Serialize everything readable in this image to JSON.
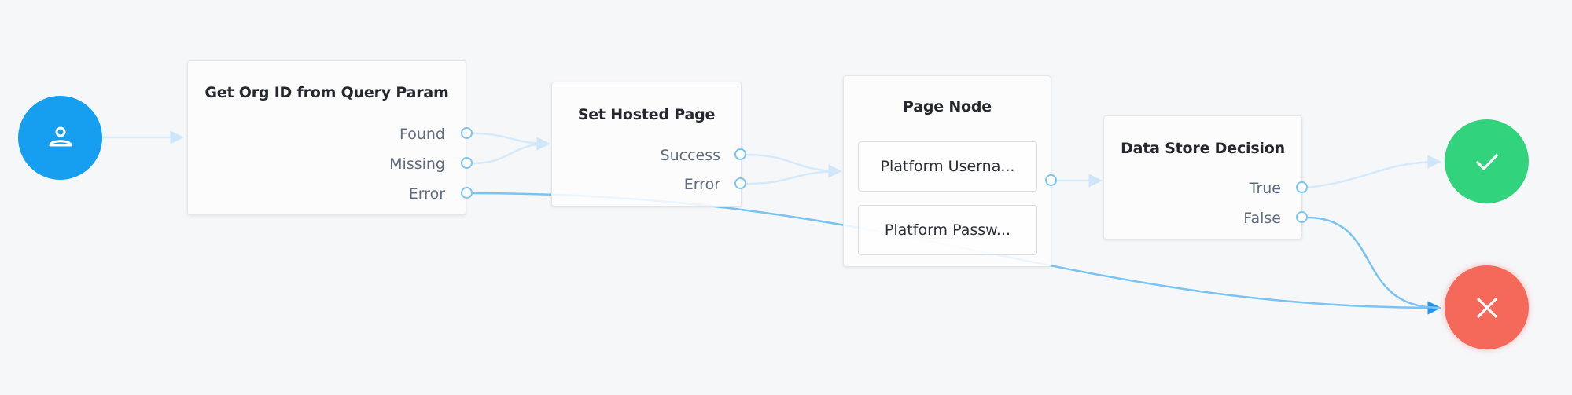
{
  "colors": {
    "background": "#f6f7f9",
    "start": "#169ff0",
    "success": "#31d47d",
    "failure": "#f5695b",
    "edge_inactive": "#d4e9fa",
    "edge_active": "#79c3f3",
    "port": "#7cc4f4",
    "outcome_text": "#5f6b80",
    "title_text": "#24272d"
  },
  "start_node": {
    "icon": "user-icon"
  },
  "nodes": [
    {
      "id": "get-org-id",
      "title": "Get Org ID from Query Param",
      "outcomes": [
        "Found",
        "Missing",
        "Error"
      ]
    },
    {
      "id": "set-hosted-page",
      "title": "Set Hosted Page",
      "outcomes": [
        "Success",
        "Error"
      ]
    },
    {
      "id": "page-node",
      "title": "Page Node",
      "children": [
        "Platform Userna...",
        "Platform Passw..."
      ]
    },
    {
      "id": "data-store-decision",
      "title": "Data Store Decision",
      "outcomes": [
        "True",
        "False"
      ]
    }
  ],
  "success_node": {
    "icon": "check-icon"
  },
  "failure_node": {
    "icon": "x-icon"
  },
  "edges": [
    {
      "from": "start",
      "to": "Get Org ID from Query Param",
      "active": false
    },
    {
      "from": "Get Org ID from Query Param:Found",
      "to": "Set Hosted Page",
      "active": false
    },
    {
      "from": "Get Org ID from Query Param:Missing",
      "to": "Set Hosted Page",
      "active": false
    },
    {
      "from": "Get Org ID from Query Param:Error",
      "to": "failure",
      "active": true
    },
    {
      "from": "Set Hosted Page:Success",
      "to": "Page Node",
      "active": false
    },
    {
      "from": "Set Hosted Page:Error",
      "to": "Page Node",
      "active": false
    },
    {
      "from": "Page Node",
      "to": "Data Store Decision",
      "active": false
    },
    {
      "from": "Data Store Decision:True",
      "to": "success",
      "active": false
    },
    {
      "from": "Data Store Decision:False",
      "to": "failure",
      "active": true
    }
  ]
}
